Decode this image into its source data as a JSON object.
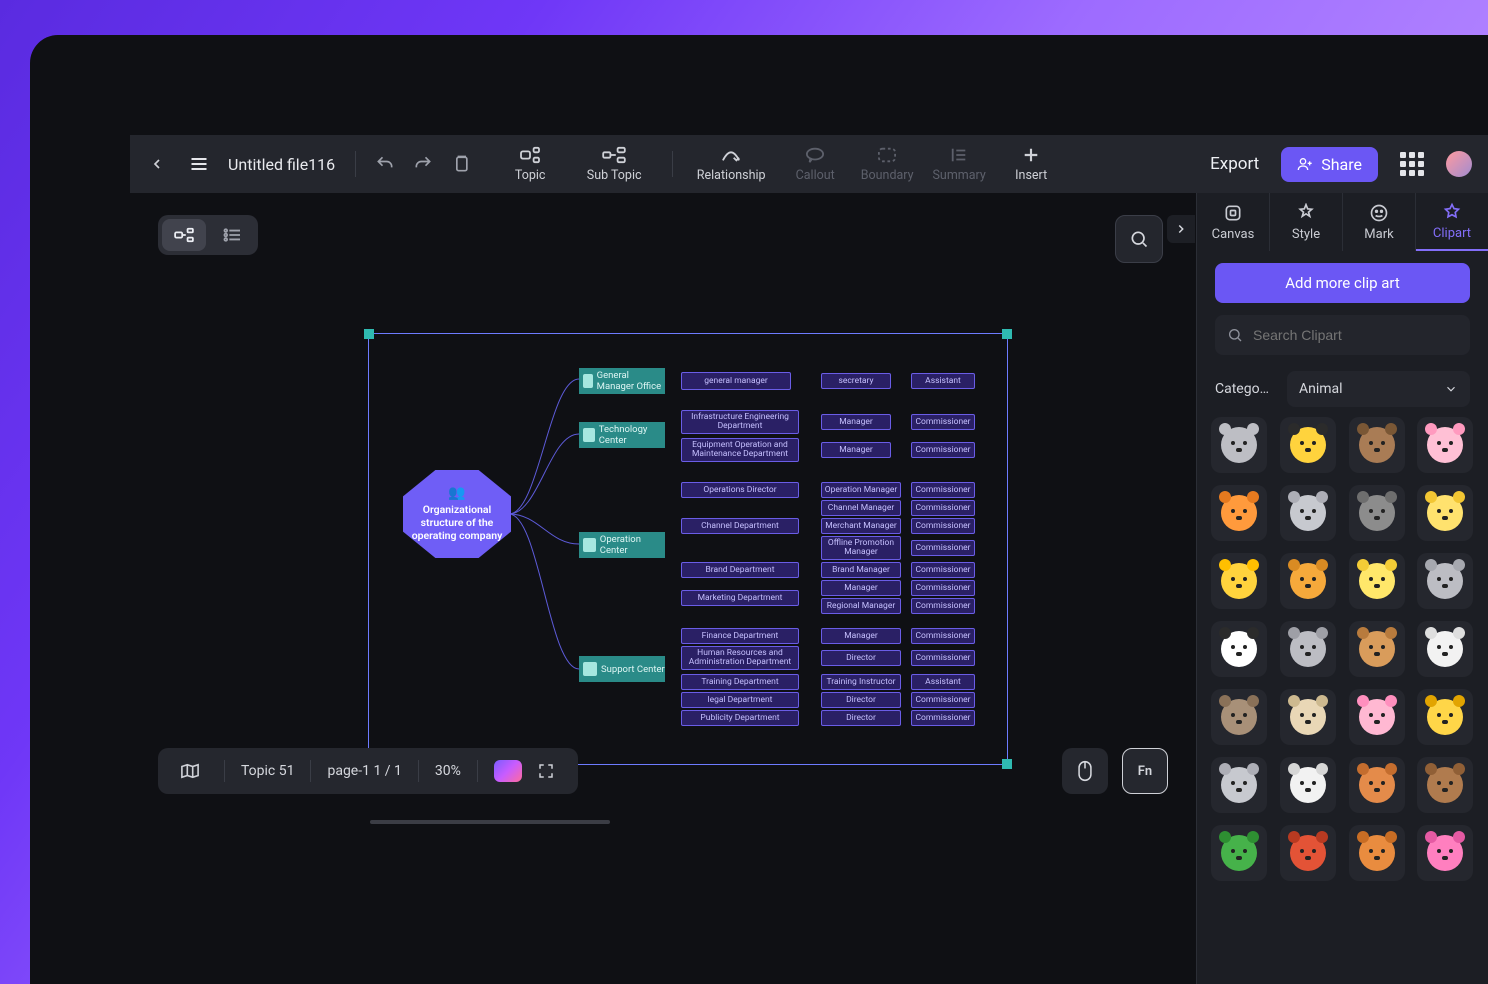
{
  "file_name": "Untitled file116",
  "toolbar": {
    "topic": "Topic",
    "subtopic": "Sub Topic",
    "relationship": "Relationship",
    "callout": "Callout",
    "boundary": "Boundary",
    "summary": "Summary",
    "insert": "Insert",
    "export": "Export",
    "share": "Share"
  },
  "bottom_bar": {
    "topic_count": "Topic 51",
    "page": "page-1  1 / 1",
    "zoom": "30%",
    "fn": "Fn"
  },
  "right_panel": {
    "tabs": {
      "canvas": "Canvas",
      "style": "Style",
      "mark": "Mark",
      "clipart": "Clipart"
    },
    "add_button": "Add more clip art",
    "search_placeholder": "Search Clipart",
    "category_label": "Catego…",
    "category_value": "Animal"
  },
  "mindmap": {
    "root": "Organizational structure of the operating company",
    "centers": {
      "gmo": "General Manager Office",
      "tech": "Technology Center",
      "ops": "Operation Center",
      "support": "Support Center"
    },
    "gmo": {
      "l3a": "general manager",
      "l3b": "secretary",
      "l3c": "Assistant"
    },
    "tech": {
      "dep1": "Infrastructure Engineering Department",
      "m1": "Manager",
      "c1": "Commissioner",
      "dep2": "Equipment Operation and Maintenance Department",
      "m2": "Manager",
      "c2": "Commissioner"
    },
    "ops": {
      "d1": "Operations Director",
      "d1a": "Operation Manager",
      "d1b": "Commissioner",
      "d2": "Channel Department",
      "d2a": "Channel Manager",
      "d2b": "Commissioner",
      "d2c": "Merchant Manager",
      "d2d": "Commissioner",
      "d2e": "Offline Promotion Manager",
      "d2f": "Commissioner",
      "d3": "Brand Department",
      "d3a": "Brand Manager",
      "d3b": "Commissioner",
      "d4": "Marketing Department",
      "d4a": "Manager",
      "d4b": "Commissioner",
      "d4c": "Regional Manager",
      "d4d": "Commissioner"
    },
    "support": {
      "s1": "Finance Department",
      "s1a": "Manager",
      "s1b": "Commissioner",
      "s2": "Human Resources and Administration Department",
      "s2a": "Director",
      "s2b": "Commissioner",
      "s3": "Training Department",
      "s3a": "Training Instructor",
      "s3b": "Assistant",
      "s4": "legal Department",
      "s4a": "Director",
      "s4b": "Commissioner",
      "s5": "Publicity Department",
      "s5a": "Director",
      "s5b": "Commissioner"
    }
  },
  "clip_colors": [
    {
      "bg": "#bdbec4",
      "ear": "#bdbec4"
    },
    {
      "bg": "#ffd33d",
      "ear": "#2b2b2b"
    },
    {
      "bg": "#a97c55",
      "ear": "#7a5735"
    },
    {
      "bg": "#ffc0d5",
      "ear": "#ff9abf"
    },
    {
      "bg": "#ff9a3c",
      "ear": "#e67a1f"
    },
    {
      "bg": "#c7c9cf",
      "ear": "#adaeb6"
    },
    {
      "bg": "#8c8c8c",
      "ear": "#6e6e6e"
    },
    {
      "bg": "#ffe26e",
      "ear": "#f2c633"
    },
    {
      "bg": "#ffd33d",
      "ear": "#ffbf00"
    },
    {
      "bg": "#f6a93b",
      "ear": "#d98b23"
    },
    {
      "bg": "#ffe76a",
      "ear": "#f3cc36"
    },
    {
      "bg": "#bcbdc3",
      "ear": "#a6a8af"
    },
    {
      "bg": "#ffffff",
      "ear": "#2b2b2b"
    },
    {
      "bg": "#bcbdc3",
      "ear": "#9e9fa6"
    },
    {
      "bg": "#d99c5b",
      "ear": "#b87b3d"
    },
    {
      "bg": "#f2f2f2",
      "ear": "#dedede"
    },
    {
      "bg": "#a89078",
      "ear": "#8a7158"
    },
    {
      "bg": "#e9d7b6",
      "ear": "#cdb98f"
    },
    {
      "bg": "#ffb8d2",
      "ear": "#ff8fbe"
    },
    {
      "bg": "#ffd648",
      "ear": "#e2a400"
    },
    {
      "bg": "#c7c9cf",
      "ear": "#adaeb6"
    },
    {
      "bg": "#f2f2f2",
      "ear": "#d6d6d6"
    },
    {
      "bg": "#e48b4a",
      "ear": "#c46d2e"
    },
    {
      "bg": "#b07b4e",
      "ear": "#905f36"
    },
    {
      "bg": "#46b24a",
      "ear": "#2e8f32"
    },
    {
      "bg": "#e35336",
      "ear": "#b83a21"
    },
    {
      "bg": "#e98c3f",
      "ear": "#c86d24"
    },
    {
      "bg": "#ff7fbf",
      "ear": "#e55aa3"
    }
  ]
}
